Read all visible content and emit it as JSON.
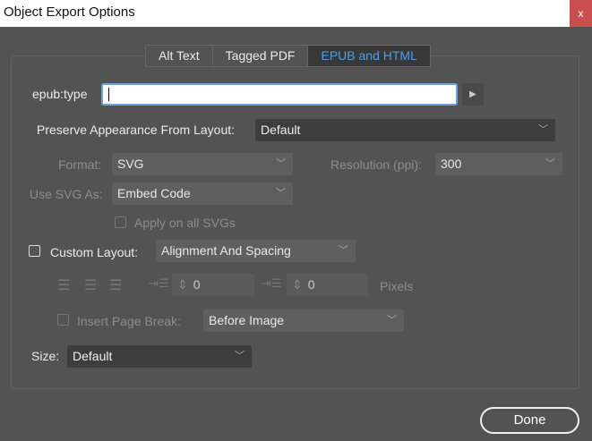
{
  "window": {
    "title": "Object Export Options",
    "close": "x"
  },
  "tabs": [
    {
      "label": "Alt Text"
    },
    {
      "label": "Tagged PDF"
    },
    {
      "label": "EPUB and HTML"
    }
  ],
  "epub": {
    "label": "epub:type",
    "value": ""
  },
  "preserve": {
    "label": "Preserve Appearance From Layout:",
    "value": "Default"
  },
  "format": {
    "label": "Format:",
    "value": "SVG"
  },
  "resolution": {
    "label": "Resolution (ppi):",
    "value": "300"
  },
  "use_svg": {
    "label": "Use SVG As:",
    "value": "Embed Code"
  },
  "apply_all": {
    "label": "Apply on all SVGs",
    "checked": false
  },
  "custom_layout": {
    "label": "Custom Layout:",
    "checked": false,
    "value": "Alignment And Spacing"
  },
  "spacing": {
    "before": "0",
    "after": "0",
    "unit": "Pixels"
  },
  "page_break": {
    "label": "Insert Page Break:",
    "checked": false,
    "value": "Before Image"
  },
  "size": {
    "label": "Size:",
    "value": "Default"
  },
  "buttons": {
    "done": "Done"
  }
}
